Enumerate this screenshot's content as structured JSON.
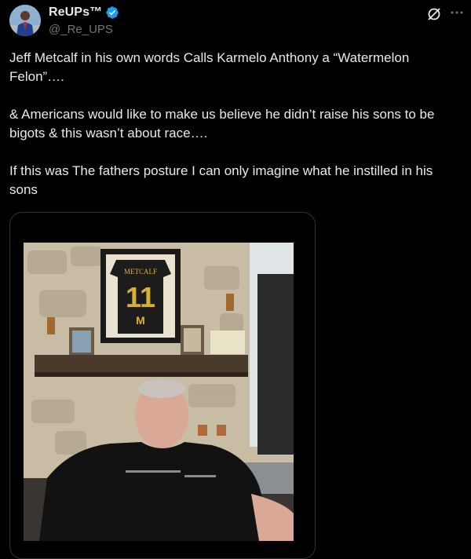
{
  "author": {
    "display_name": "ReUPs™",
    "handle": "@_Re_UPS",
    "verified": true
  },
  "tweet": {
    "paragraphs": [
      "Jeff Metcalf in his own words Calls Karmelo Anthony a “Watermelon Felon”….",
      "& Americans would like to make us believe he didn’t raise his sons to be bigots & this wasn’t about race….",
      "If this was The fathers posture I can only imagine what he instilled in his sons"
    ]
  },
  "media": {
    "jersey_name": "METCALF",
    "jersey_number": "11",
    "jersey_letter": "M"
  },
  "colors": {
    "background": "#000000",
    "text": "#e7e9ea",
    "secondary_text": "#71767b",
    "verified": "#1d9bf0",
    "border": "#2f3336"
  },
  "icons": [
    "verified-badge-icon",
    "grok-icon",
    "more-icon"
  ]
}
